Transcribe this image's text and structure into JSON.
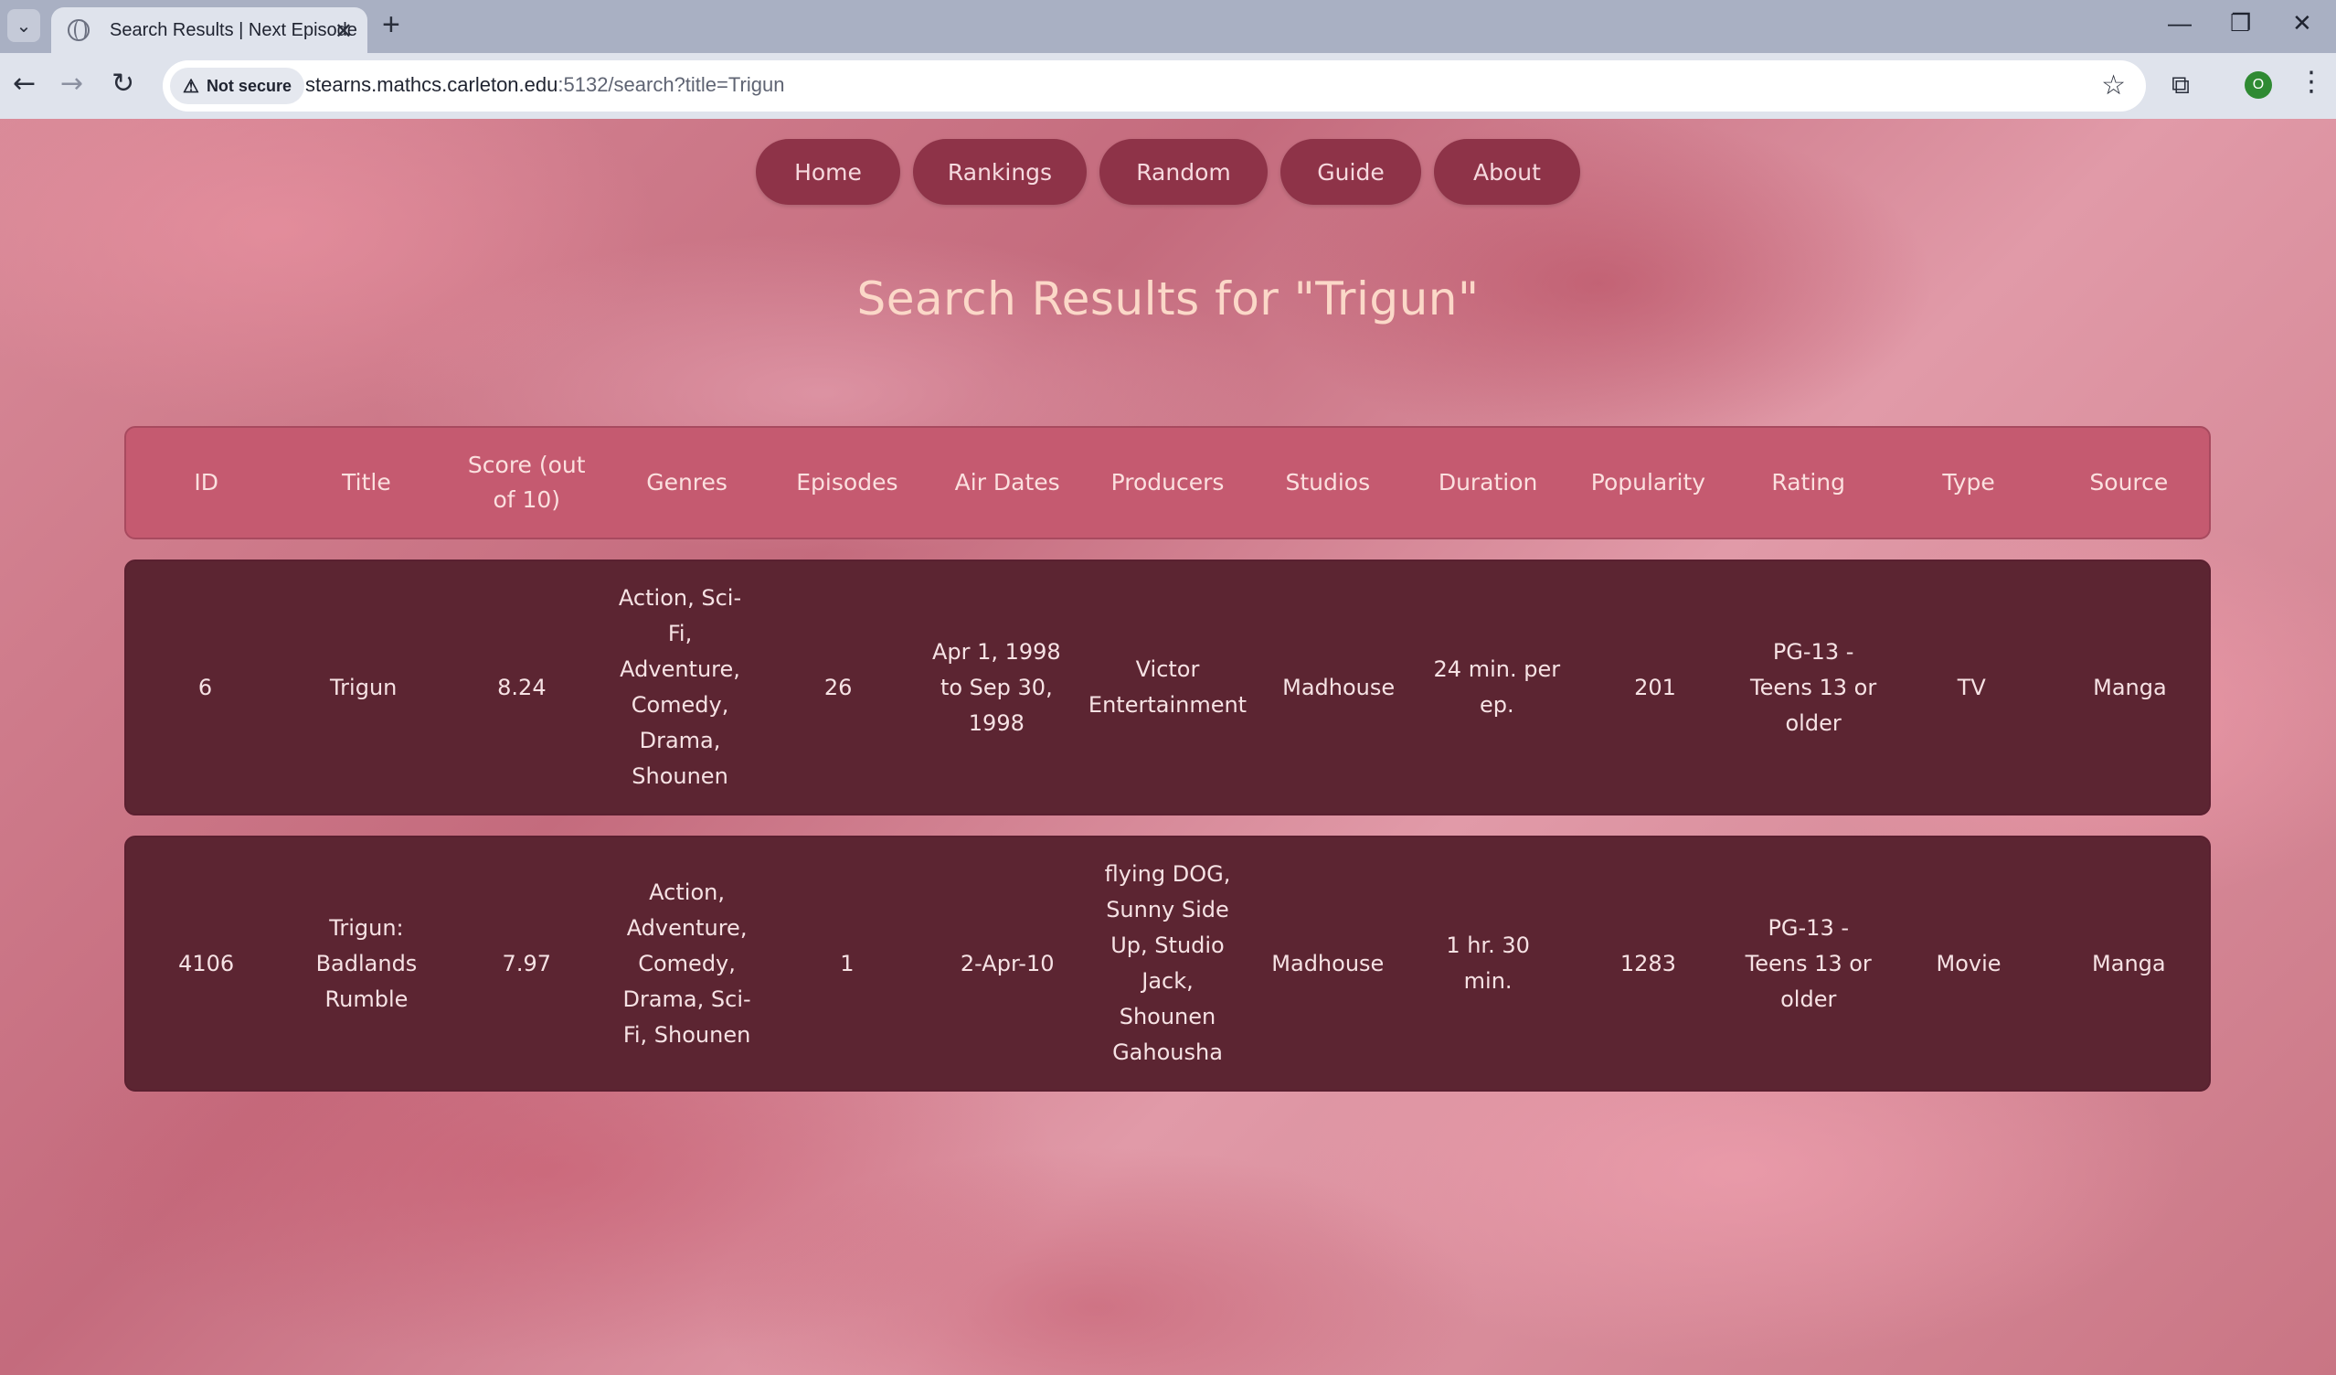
{
  "browser": {
    "tab_title": "Search Results | Next Episode",
    "security_label": "Not secure",
    "url_host": "stearns.mathcs.carleton.edu",
    "url_rest": ":5132/search?title=Trigun",
    "profile_initial": "O"
  },
  "nav": {
    "items": [
      {
        "label": "Home"
      },
      {
        "label": "Rankings"
      },
      {
        "label": "Random"
      },
      {
        "label": "Guide"
      },
      {
        "label": "About"
      }
    ]
  },
  "page": {
    "heading": "Search Results for \"Trigun\""
  },
  "table": {
    "headers": [
      "ID",
      "Title",
      "Score (out of 10)",
      "Genres",
      "Episodes",
      "Air Dates",
      "Producers",
      "Studios",
      "Duration",
      "Popularity",
      "Rating",
      "Type",
      "Source"
    ],
    "rows": [
      [
        "6",
        "Trigun",
        "8.24",
        "Action, Sci-Fi, Adventure, Comedy, Drama, Shounen",
        "26",
        "Apr 1, 1998 to Sep 30, 1998",
        "Victor Entertainment",
        "Madhouse",
        "24 min. per ep.",
        "201",
        "PG-13 - Teens 13 or older",
        "TV",
        "Manga"
      ],
      [
        "4106",
        "Trigun: Badlands Rumble",
        "7.97",
        "Action, Adventure, Comedy, Drama, Sci-Fi, Shounen",
        "1",
        "2-Apr-10",
        "flying DOG, Sunny Side Up, Studio Jack, Shounen Gahousha",
        "Madhouse",
        "1 hr. 30 min.",
        "1283",
        "PG-13 - Teens 13 or older",
        "Movie",
        "Manga"
      ]
    ]
  }
}
